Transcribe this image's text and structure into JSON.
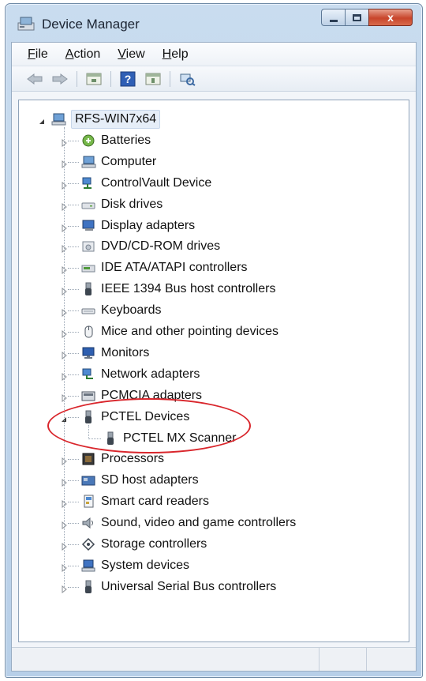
{
  "window": {
    "title": "Device Manager",
    "close_glyph": "x"
  },
  "menu": {
    "items": [
      {
        "label": "File",
        "accel": "F",
        "rest": "ile"
      },
      {
        "label": "Action",
        "accel": "A",
        "rest": "ction"
      },
      {
        "label": "View",
        "accel": "V",
        "rest": "iew"
      },
      {
        "label": "Help",
        "accel": "H",
        "rest": "elp"
      }
    ]
  },
  "toolbar": {
    "buttons": [
      "back-icon",
      "forward-icon",
      "properties-icon",
      "help-icon",
      "update-driver-icon",
      "scan-hardware-icon"
    ]
  },
  "tree": {
    "root": {
      "label": "RFS-WIN7x64",
      "icon": "computer-icon",
      "expanded": true
    },
    "categories": [
      {
        "label": "Batteries",
        "icon": "battery-icon"
      },
      {
        "label": "Computer",
        "icon": "computer-icon"
      },
      {
        "label": "ControlVault Device",
        "icon": "network-device-icon"
      },
      {
        "label": "Disk drives",
        "icon": "disk-drive-icon"
      },
      {
        "label": "Display adapters",
        "icon": "display-adapter-icon"
      },
      {
        "label": "DVD/CD-ROM drives",
        "icon": "dvd-drive-icon"
      },
      {
        "label": "IDE ATA/ATAPI controllers",
        "icon": "ide-controller-icon"
      },
      {
        "label": "IEEE 1394 Bus host controllers",
        "icon": "usb-plug-icon"
      },
      {
        "label": "Keyboards",
        "icon": "keyboard-icon"
      },
      {
        "label": "Mice and other pointing devices",
        "icon": "mouse-icon"
      },
      {
        "label": "Monitors",
        "icon": "monitor-icon"
      },
      {
        "label": "Network adapters",
        "icon": "network-adapter-icon"
      },
      {
        "label": "PCMCIA adapters",
        "icon": "pcmcia-icon"
      },
      {
        "label": "PCTEL Devices",
        "icon": "usb-plug-icon",
        "expanded": true,
        "children": [
          {
            "label": "PCTEL MX Scanner",
            "icon": "usb-plug-icon"
          }
        ]
      },
      {
        "label": "Processors",
        "icon": "processor-icon"
      },
      {
        "label": "SD host adapters",
        "icon": "sd-adapter-icon"
      },
      {
        "label": "Smart card readers",
        "icon": "smart-card-icon"
      },
      {
        "label": "Sound, video and game controllers",
        "icon": "speaker-icon"
      },
      {
        "label": "Storage controllers",
        "icon": "storage-icon"
      },
      {
        "label": "System devices",
        "icon": "system-device-icon"
      },
      {
        "label": "Universal Serial Bus controllers",
        "icon": "usb-plug-icon"
      }
    ]
  },
  "colors": {
    "annotation": "#d9262c",
    "title_bar": "#c9dcef",
    "close_button": "#c8452b"
  }
}
